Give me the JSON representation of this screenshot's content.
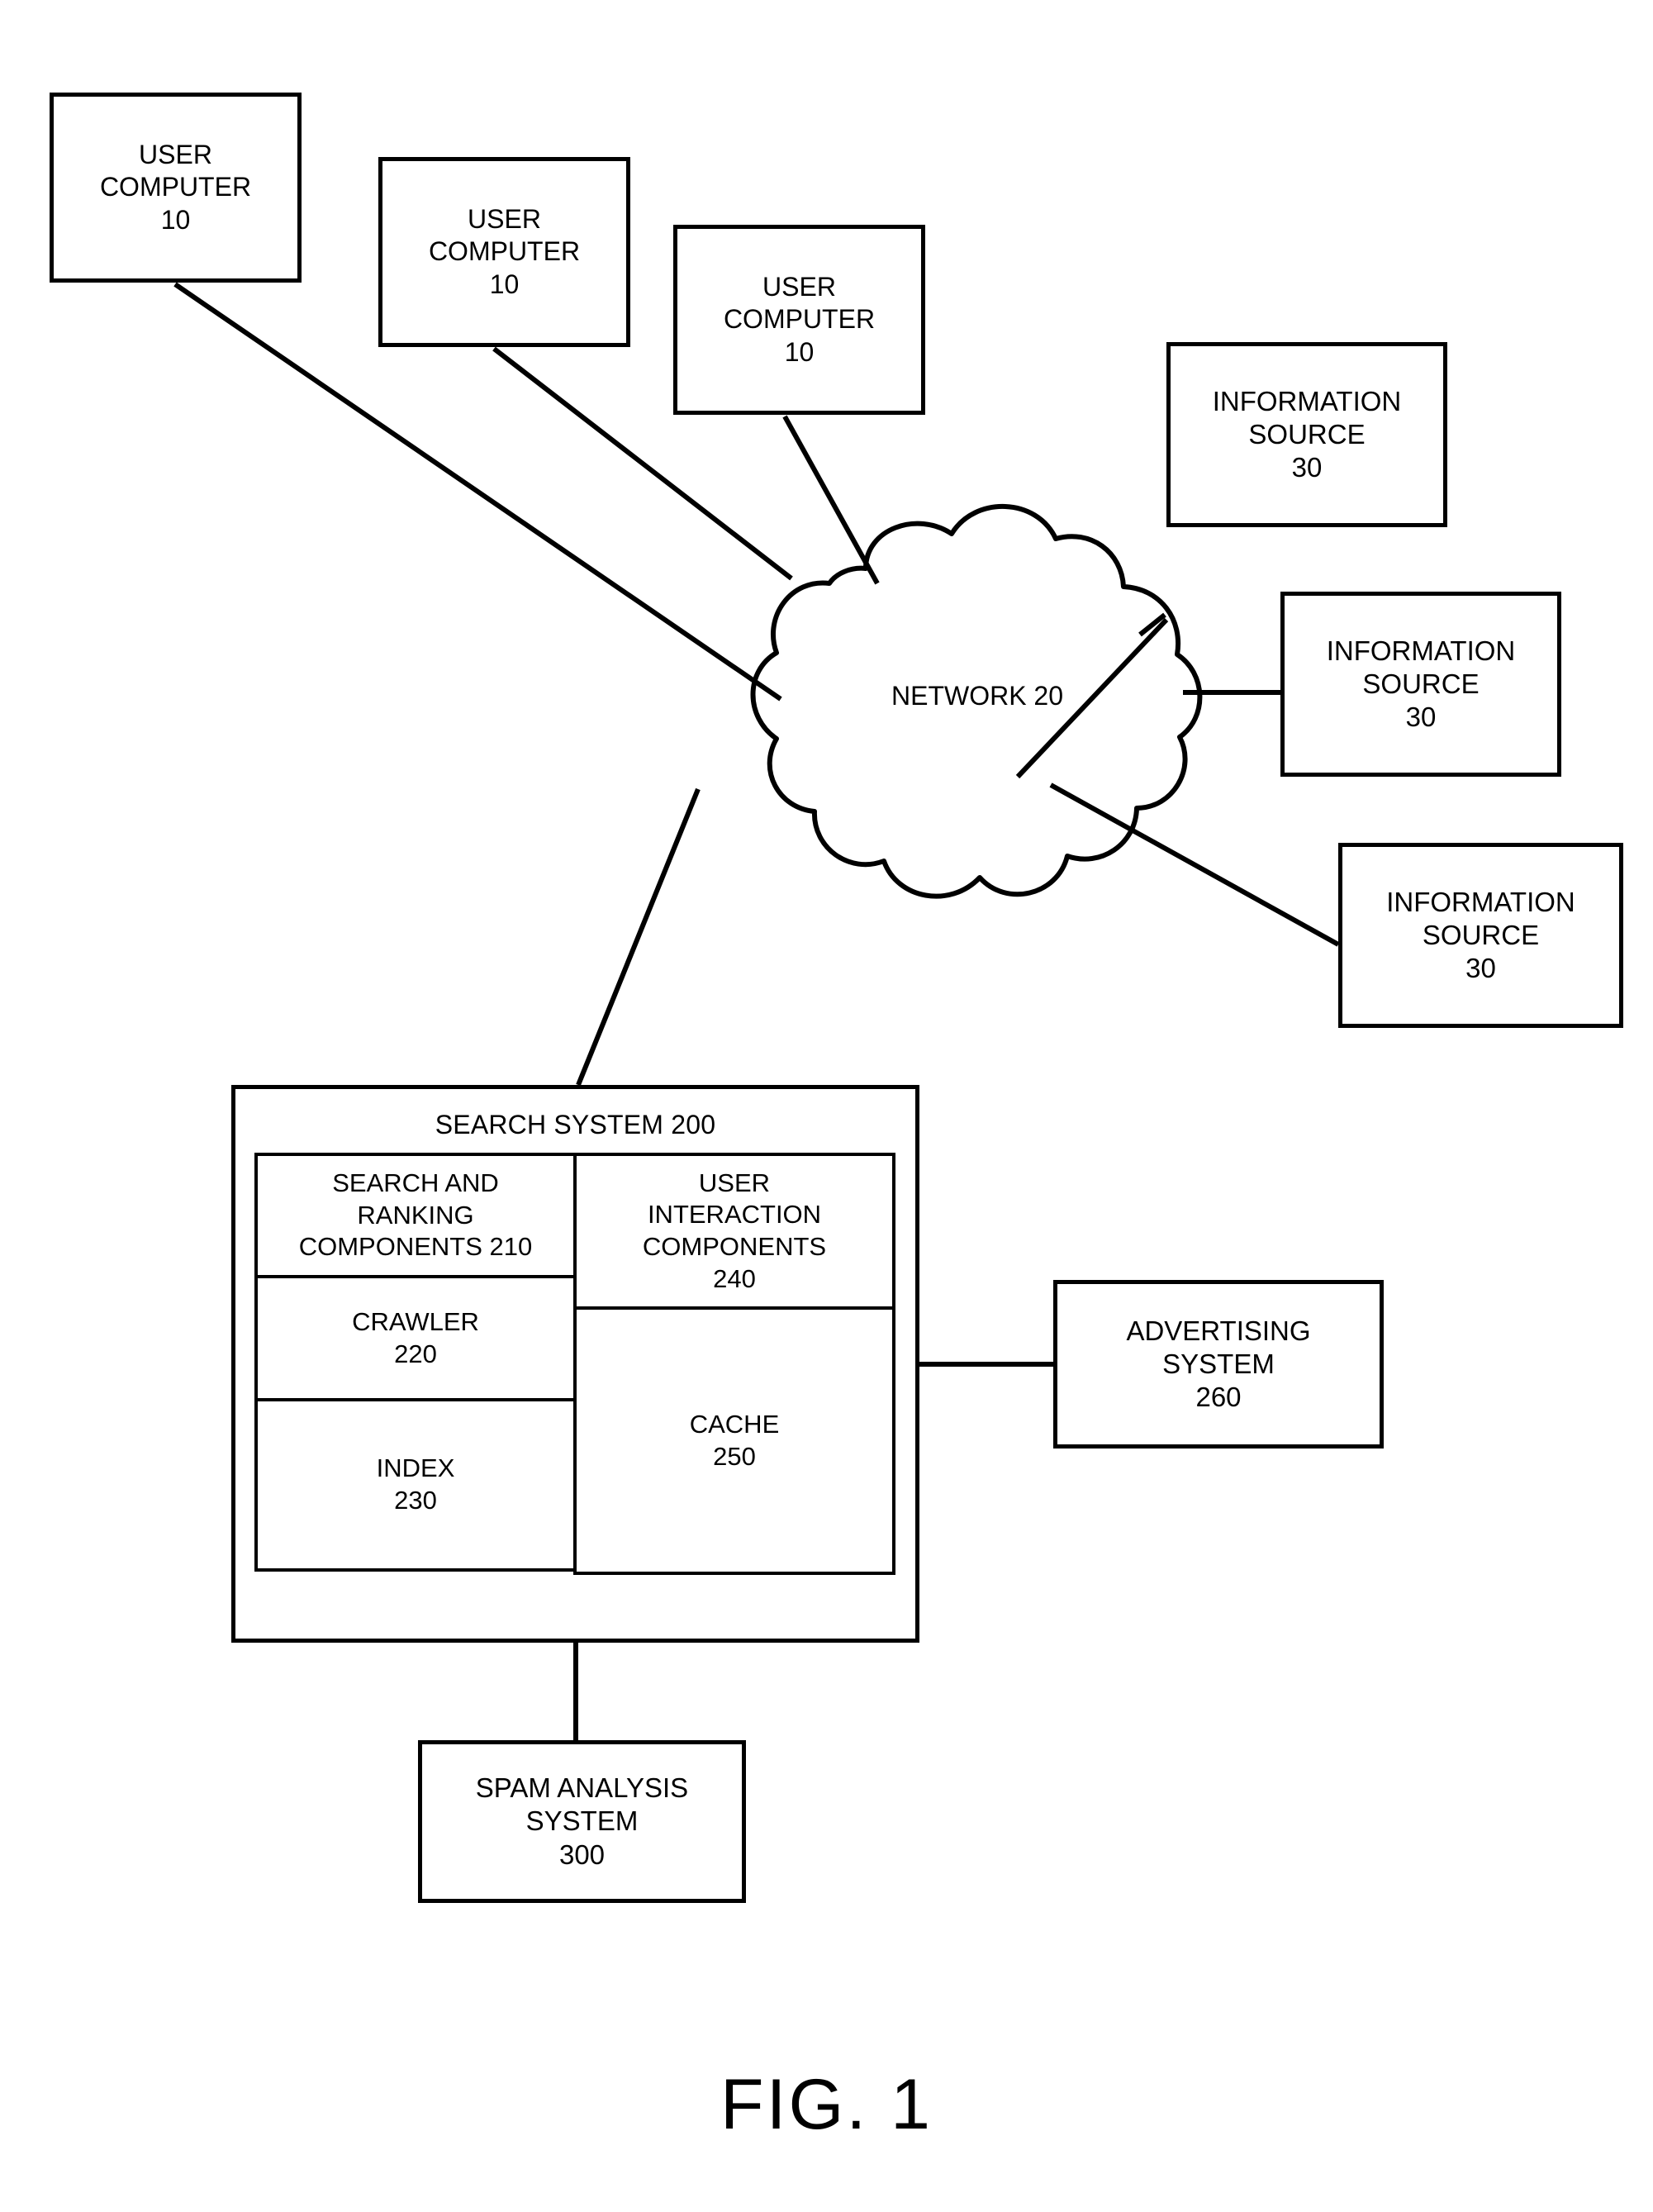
{
  "figure": {
    "caption": "FIG. 1"
  },
  "nodes": {
    "user_computers": [
      {
        "line1": "USER",
        "line2": "COMPUTER",
        "ref": "10"
      },
      {
        "line1": "USER",
        "line2": "COMPUTER",
        "ref": "10"
      },
      {
        "line1": "USER",
        "line2": "COMPUTER",
        "ref": "10"
      }
    ],
    "network": {
      "label": "NETWORK",
      "ref": "20"
    },
    "information_sources": [
      {
        "line1": "INFORMATION",
        "line2": "SOURCE",
        "ref": "30"
      },
      {
        "line1": "INFORMATION",
        "line2": "SOURCE",
        "ref": "30"
      },
      {
        "line1": "INFORMATION",
        "line2": "SOURCE",
        "ref": "30"
      }
    ],
    "search_system": {
      "title": "SEARCH SYSTEM 200",
      "components": {
        "search_and_ranking": {
          "line1": "SEARCH AND",
          "line2": "RANKING",
          "line3": "COMPONENTS 210"
        },
        "crawler": {
          "line1": "CRAWLER",
          "ref": "220"
        },
        "index": {
          "line1": "INDEX",
          "ref": "230"
        },
        "user_interaction": {
          "line1": "USER",
          "line2": "INTERACTION",
          "line3": "COMPONENTS",
          "ref": "240"
        },
        "cache": {
          "line1": "CACHE",
          "ref": "250"
        }
      }
    },
    "advertising_system": {
      "line1": "ADVERTISING",
      "line2": "SYSTEM",
      "ref": "260"
    },
    "spam_analysis_system": {
      "line1": "SPAM ANALYSIS",
      "line2": "SYSTEM",
      "ref": "300"
    }
  },
  "style": {
    "stroke": "#000000",
    "background": "#ffffff"
  }
}
